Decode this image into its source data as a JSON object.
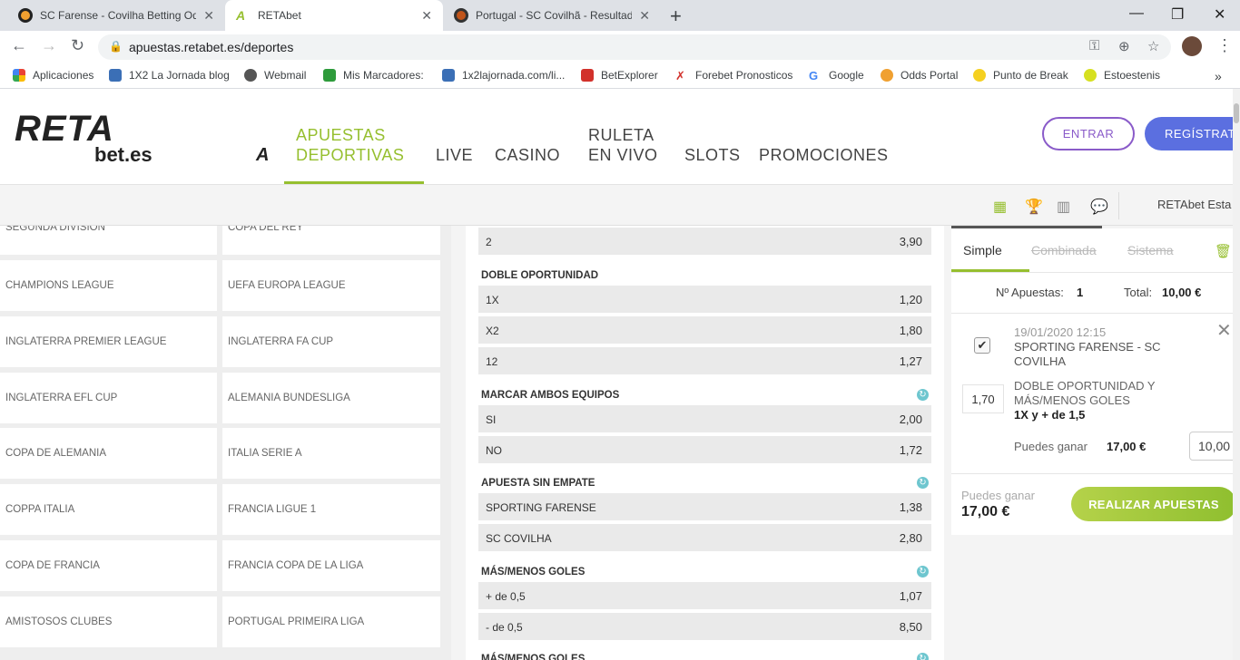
{
  "browser": {
    "tabs": [
      {
        "title": "SC Farense - Covilha Betting Odds",
        "active": false
      },
      {
        "title": "RETAbet",
        "active": true
      },
      {
        "title": "Portugal - SC Covilhã - Resultados",
        "active": false
      }
    ],
    "url": "apuestas.retabet.es/deportes",
    "bookmarks": [
      "Aplicaciones",
      "1X2 La Jornada blog",
      "Webmail",
      "Mis Marcadores:",
      "1x2lajornada.com/li...",
      "BetExplorer",
      "Forebet Pronosticos",
      "Google",
      "Odds Portal",
      "Punto de Break",
      "Estoestenis"
    ]
  },
  "site": {
    "logo_top": "RETA",
    "logo_bottom": "bet.es",
    "nav": [
      {
        "line1": "APUESTAS",
        "line2": "DEPORTIVAS"
      },
      {
        "line1": "LIVE",
        "line2": ""
      },
      {
        "line1": "CASINO",
        "line2": ""
      },
      {
        "line1": "RULETA",
        "line2": "EN VIVO"
      },
      {
        "line1": "SLOTS",
        "line2": ""
      },
      {
        "line1": "PROMOCIONES",
        "line2": ""
      }
    ],
    "entrar_label": "ENTRAR",
    "registrate_label": "REGÍSTRATE",
    "subbar_text": "RETAbet Esta"
  },
  "leagues": [
    [
      "SEGUNDA DIVISION",
      "COPA DEL REY"
    ],
    [
      "CHAMPIONS LEAGUE",
      "UEFA EUROPA LEAGUE"
    ],
    [
      "INGLATERRA PREMIER LEAGUE",
      "INGLATERRA FA CUP"
    ],
    [
      "INGLATERRA EFL CUP",
      "ALEMANIA BUNDESLIGA"
    ],
    [
      "COPA DE ALEMANIA",
      "ITALIA SERIE A"
    ],
    [
      "COPPA ITALIA",
      "FRANCIA LIGUE 1"
    ],
    [
      "COPA DE FRANCIA",
      "FRANCIA COPA DE LA LIGA"
    ],
    [
      "AMISTOSOS CLUBES",
      "PORTUGAL PRIMEIRA LIGA"
    ]
  ],
  "markets": {
    "top_row": {
      "label": "2",
      "odd": "3,90"
    },
    "groups": [
      {
        "title": "DOBLE OPORTUNIDAD",
        "rows": [
          {
            "label": "1X",
            "odd": "1,20"
          },
          {
            "label": "X2",
            "odd": "1,80"
          },
          {
            "label": "12",
            "odd": "1,27"
          }
        ]
      },
      {
        "title": "MARCAR AMBOS EQUIPOS",
        "rows": [
          {
            "label": "SI",
            "odd": "2,00"
          },
          {
            "label": "NO",
            "odd": "1,72"
          }
        ]
      },
      {
        "title": "APUESTA SIN EMPATE",
        "rows": [
          {
            "label": "SPORTING FARENSE",
            "odd": "1,38"
          },
          {
            "label": "SC COVILHA",
            "odd": "2,80"
          }
        ]
      },
      {
        "title": "MÁS/MENOS GOLES",
        "rows": [
          {
            "label": "+ de 0,5",
            "odd": "1,07"
          },
          {
            "label": "- de 0,5",
            "odd": "8,50"
          }
        ]
      },
      {
        "title": "MÁS/MENOS GOLES",
        "rows": []
      }
    ]
  },
  "betslip": {
    "tabs": [
      "Simple",
      "Combinada",
      "Sistema"
    ],
    "num_label": "Nº Apuestas:",
    "num_value": "1",
    "total_label": "Total:",
    "total_value": "10,00 €",
    "bet": {
      "date": "19/01/2020 12:15",
      "match": "SPORTING FARENSE - SC COVILHA",
      "market": "DOBLE OPORTUNIDAD Y MÁS/MENOS GOLES",
      "selection": "1X y + de 1,5",
      "odd": "1,70",
      "win_label": "Puedes ganar",
      "win_value": "17,00 €",
      "stake": "10,00"
    },
    "footer_win_label": "Puedes ganar",
    "footer_win_value": "17,00 €",
    "submit_label": "REALIZAR APUESTAS"
  }
}
